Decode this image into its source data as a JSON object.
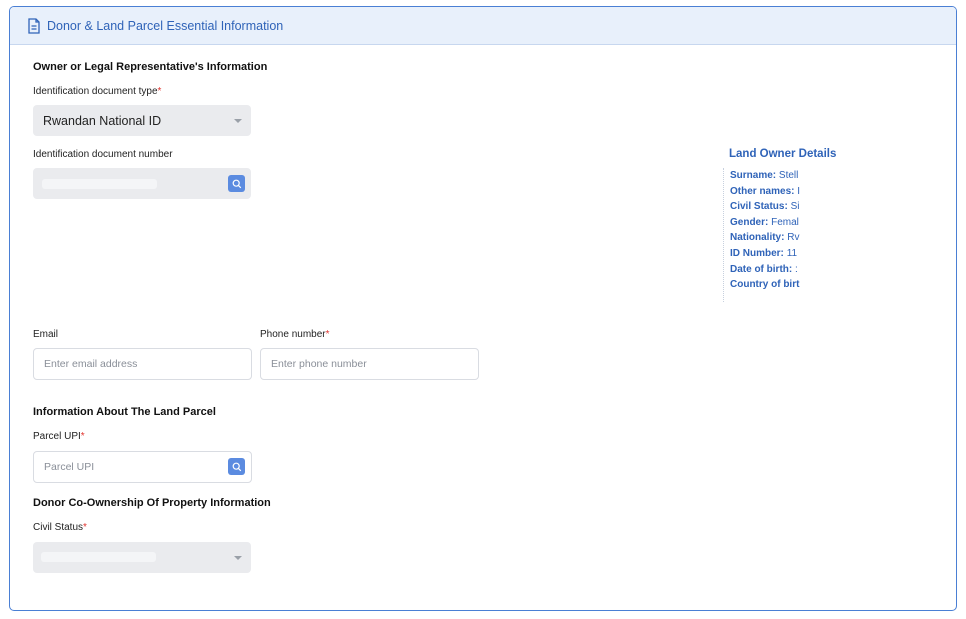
{
  "header": {
    "title": "Donor & Land Parcel Essential Information"
  },
  "owner_section": {
    "title": "Owner or Legal Representative's Information",
    "id_type_label": "Identification document type",
    "id_type_value": "Rwandan National ID",
    "id_number_label": "Identification document number",
    "email_label": "Email",
    "email_placeholder": "Enter email address",
    "phone_label": "Phone number",
    "phone_placeholder": "Enter phone number"
  },
  "land_owner_details": {
    "title": "Land Owner Details",
    "rows": [
      {
        "key": "Surname:",
        "value": "Stell"
      },
      {
        "key": "Other names:",
        "value": "I"
      },
      {
        "key": "Civil Status:",
        "value": "Si"
      },
      {
        "key": "Gender:",
        "value": "Femal"
      },
      {
        "key": "Nationality:",
        "value": "Rv"
      },
      {
        "key": "ID Number:",
        "value": "11"
      },
      {
        "key": "Date of birth:",
        "value": ":"
      },
      {
        "key": "Country of birt",
        "value": ""
      }
    ]
  },
  "parcel_section": {
    "title": "Information About The Land Parcel",
    "upi_label": "Parcel UPI",
    "upi_placeholder": "Parcel UPI"
  },
  "coownership_section": {
    "title": "Donor Co-Ownership Of Property Information",
    "civil_status_label": "Civil Status"
  },
  "required_marker": "*",
  "colors": {
    "accent": "#2f63b8",
    "required": "#e0342f",
    "button": "#5b8be0"
  }
}
